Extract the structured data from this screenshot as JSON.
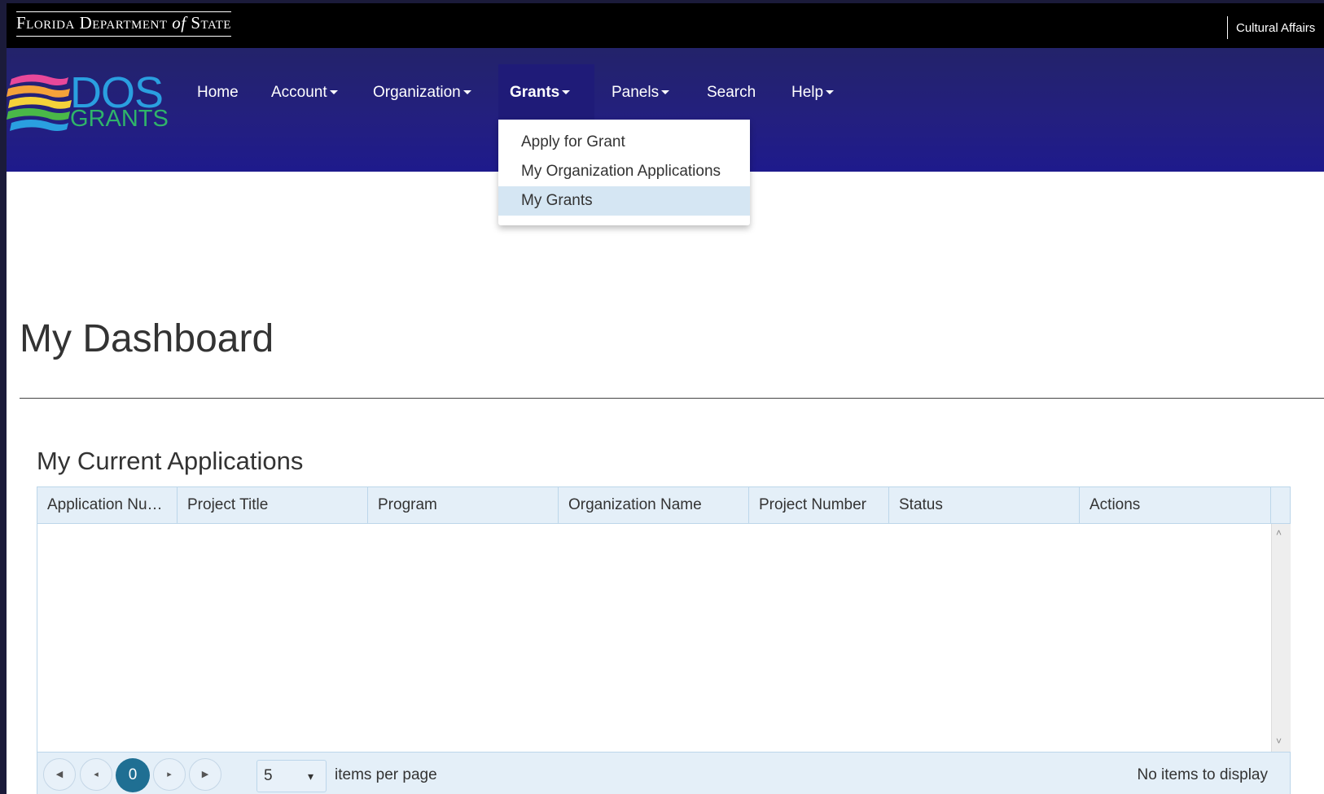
{
  "topbar": {
    "agency_logo_text": "Florida Department of State",
    "agency_logo_parts": [
      "Florida Department ",
      "of",
      " State"
    ],
    "division_link": "Cultural Affairs"
  },
  "logo": {
    "line1": "DOS",
    "line2": "GRANTS",
    "colors": {
      "dos": "#2a9fe0",
      "grants": "#2fb46a"
    }
  },
  "nav": {
    "items": [
      {
        "label": "Home",
        "has_dropdown": false
      },
      {
        "label": "Account",
        "has_dropdown": true
      },
      {
        "label": "Organization",
        "has_dropdown": true
      },
      {
        "label": "Grants",
        "has_dropdown": true,
        "active": true
      },
      {
        "label": "Panels",
        "has_dropdown": true
      },
      {
        "label": "Search",
        "has_dropdown": false
      },
      {
        "label": "Help",
        "has_dropdown": true
      }
    ]
  },
  "grants_menu": {
    "items": [
      {
        "label": "Apply for Grant"
      },
      {
        "label": "My Organization Applications"
      },
      {
        "label": "My Grants",
        "highlighted": true
      }
    ]
  },
  "page": {
    "title": "My Dashboard",
    "section_title": "My Current Applications"
  },
  "grid": {
    "columns": [
      "Application Nu…",
      "Project Title",
      "Program",
      "Organization Name",
      "Project Number",
      "Status",
      "Actions"
    ],
    "rows": [],
    "pager": {
      "current_page": "0",
      "page_size": "5",
      "items_per_page_label": "items per page",
      "empty_message": "No items to display"
    }
  },
  "colors": {
    "topbar_bg": "#000000",
    "navbar_bg": "#23236a",
    "grid_header_bg": "#e4eff8",
    "pager_current_bg": "#1f6f93",
    "dropdown_highlight": "#d5e6f3"
  },
  "icons": {
    "pager_first": "first-page-icon",
    "pager_prev": "prev-page-icon",
    "pager_next": "next-page-icon",
    "pager_last": "last-page-icon",
    "scroll_up": "chevron-up-icon",
    "scroll_down": "chevron-down-icon",
    "dropdown_caret": "caret-down-icon"
  }
}
